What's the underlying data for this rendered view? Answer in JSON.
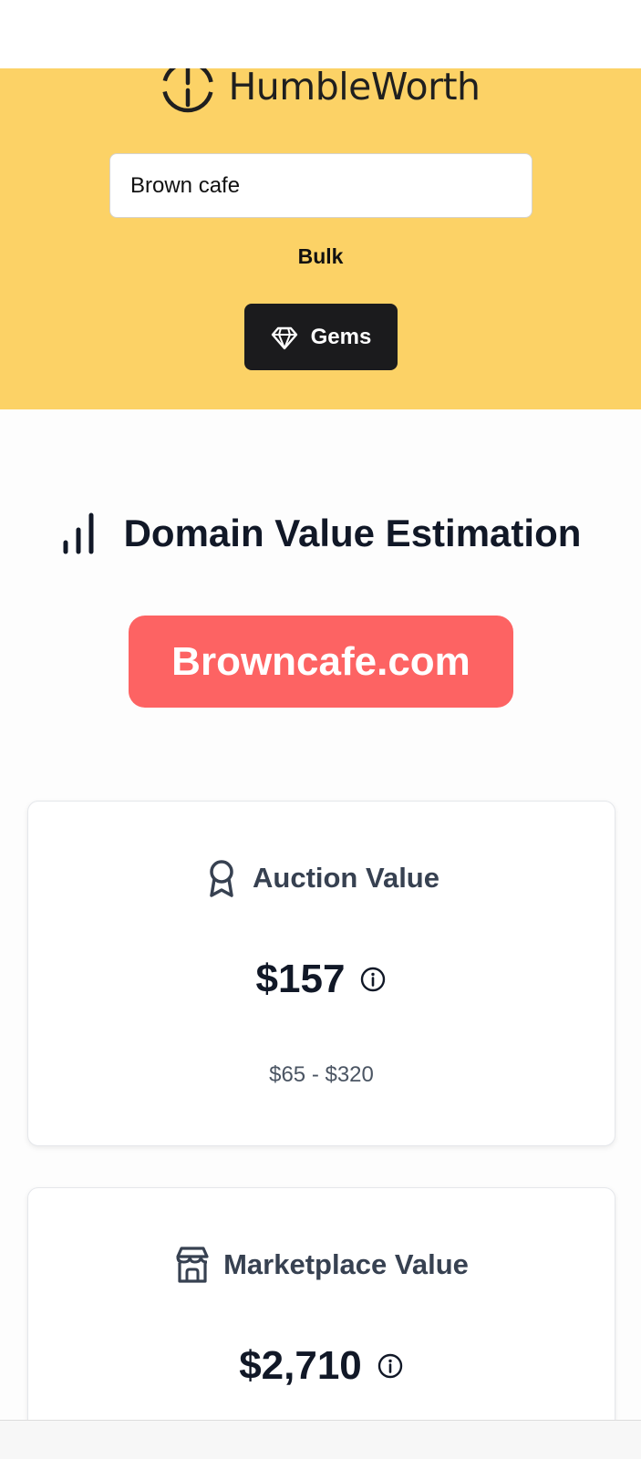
{
  "header": {
    "brand": "HumbleWorth",
    "search_value": "Brown cafe",
    "bulk_label": "Bulk",
    "gems_label": "Gems",
    "background_color": "#fcd266"
  },
  "main": {
    "title": "Domain Value Estimation",
    "domain": "Browncafe.com",
    "domain_color": "#fd6363"
  },
  "cards": {
    "auction": {
      "title": "Auction Value",
      "value": "$157",
      "range": "$65 - $320",
      "icon": "award-icon"
    },
    "marketplace": {
      "title": "Marketplace Value",
      "value": "$2,710",
      "icon": "store-icon"
    }
  }
}
